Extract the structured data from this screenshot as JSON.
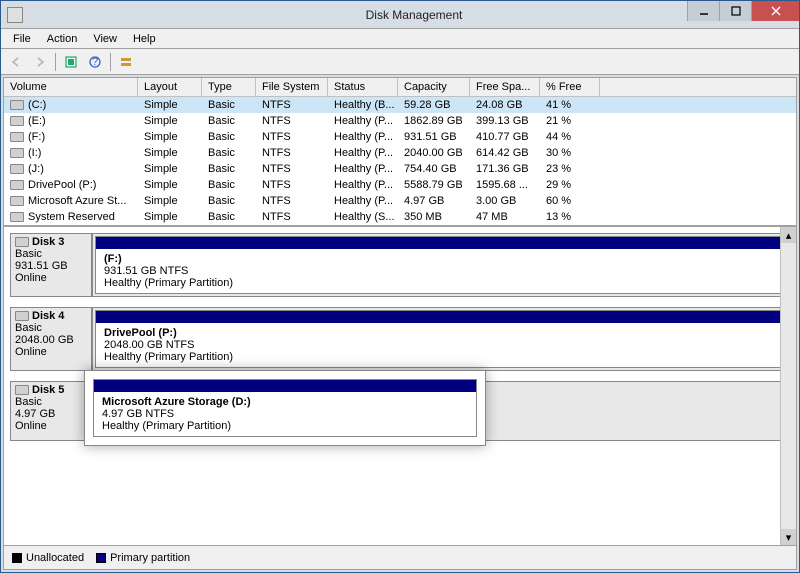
{
  "window": {
    "title": "Disk Management"
  },
  "menu": {
    "file": "File",
    "action": "Action",
    "view": "View",
    "help": "Help"
  },
  "columns": {
    "volume": "Volume",
    "layout": "Layout",
    "type": "Type",
    "fs": "File System",
    "status": "Status",
    "capacity": "Capacity",
    "free": "Free Spa...",
    "pct": "% Free"
  },
  "volumes": [
    {
      "name": "(C:)",
      "layout": "Simple",
      "type": "Basic",
      "fs": "NTFS",
      "status": "Healthy (B...",
      "capacity": "59.28 GB",
      "free": "24.08 GB",
      "pct": "41 %",
      "selected": true
    },
    {
      "name": "(E:)",
      "layout": "Simple",
      "type": "Basic",
      "fs": "NTFS",
      "status": "Healthy (P...",
      "capacity": "1862.89 GB",
      "free": "399.13 GB",
      "pct": "21 %"
    },
    {
      "name": "(F:)",
      "layout": "Simple",
      "type": "Basic",
      "fs": "NTFS",
      "status": "Healthy (P...",
      "capacity": "931.51 GB",
      "free": "410.77 GB",
      "pct": "44 %"
    },
    {
      "name": "(I:)",
      "layout": "Simple",
      "type": "Basic",
      "fs": "NTFS",
      "status": "Healthy (P...",
      "capacity": "2040.00 GB",
      "free": "614.42 GB",
      "pct": "30 %"
    },
    {
      "name": "(J:)",
      "layout": "Simple",
      "type": "Basic",
      "fs": "NTFS",
      "status": "Healthy (P...",
      "capacity": "754.40 GB",
      "free": "171.36 GB",
      "pct": "23 %"
    },
    {
      "name": "DrivePool (P:)",
      "layout": "Simple",
      "type": "Basic",
      "fs": "NTFS",
      "status": "Healthy (P...",
      "capacity": "5588.79 GB",
      "free": "1595.68 ...",
      "pct": "29 %"
    },
    {
      "name": "Microsoft Azure St...",
      "layout": "Simple",
      "type": "Basic",
      "fs": "NTFS",
      "status": "Healthy (P...",
      "capacity": "4.97 GB",
      "free": "3.00 GB",
      "pct": "60 %"
    },
    {
      "name": "System Reserved",
      "layout": "Simple",
      "type": "Basic",
      "fs": "NTFS",
      "status": "Healthy (S...",
      "capacity": "350 MB",
      "free": "47 MB",
      "pct": "13 %"
    }
  ],
  "disks": [
    {
      "name": "Disk 3",
      "type": "Basic",
      "size": "931.51 GB",
      "status": "Online",
      "part": {
        "title": "(F:)",
        "line2": "931.51 GB NTFS",
        "line3": "Healthy (Primary Partition)"
      }
    },
    {
      "name": "Disk 4",
      "type": "Basic",
      "size": "2048.00 GB",
      "status": "Online",
      "part": {
        "title": "DrivePool  (P:)",
        "line2": "2048.00 GB NTFS",
        "line3": "Healthy (Primary Partition)"
      }
    },
    {
      "name": "Disk 5",
      "type": "Basic",
      "size": "4.97 GB",
      "status": "Online",
      "part": {
        "title": "Microsoft Azure Storage  (D:)",
        "line2": "4.97 GB NTFS",
        "line3": "Healthy (Primary Partition)"
      }
    }
  ],
  "legend": {
    "unallocated": "Unallocated",
    "primary": "Primary partition"
  }
}
